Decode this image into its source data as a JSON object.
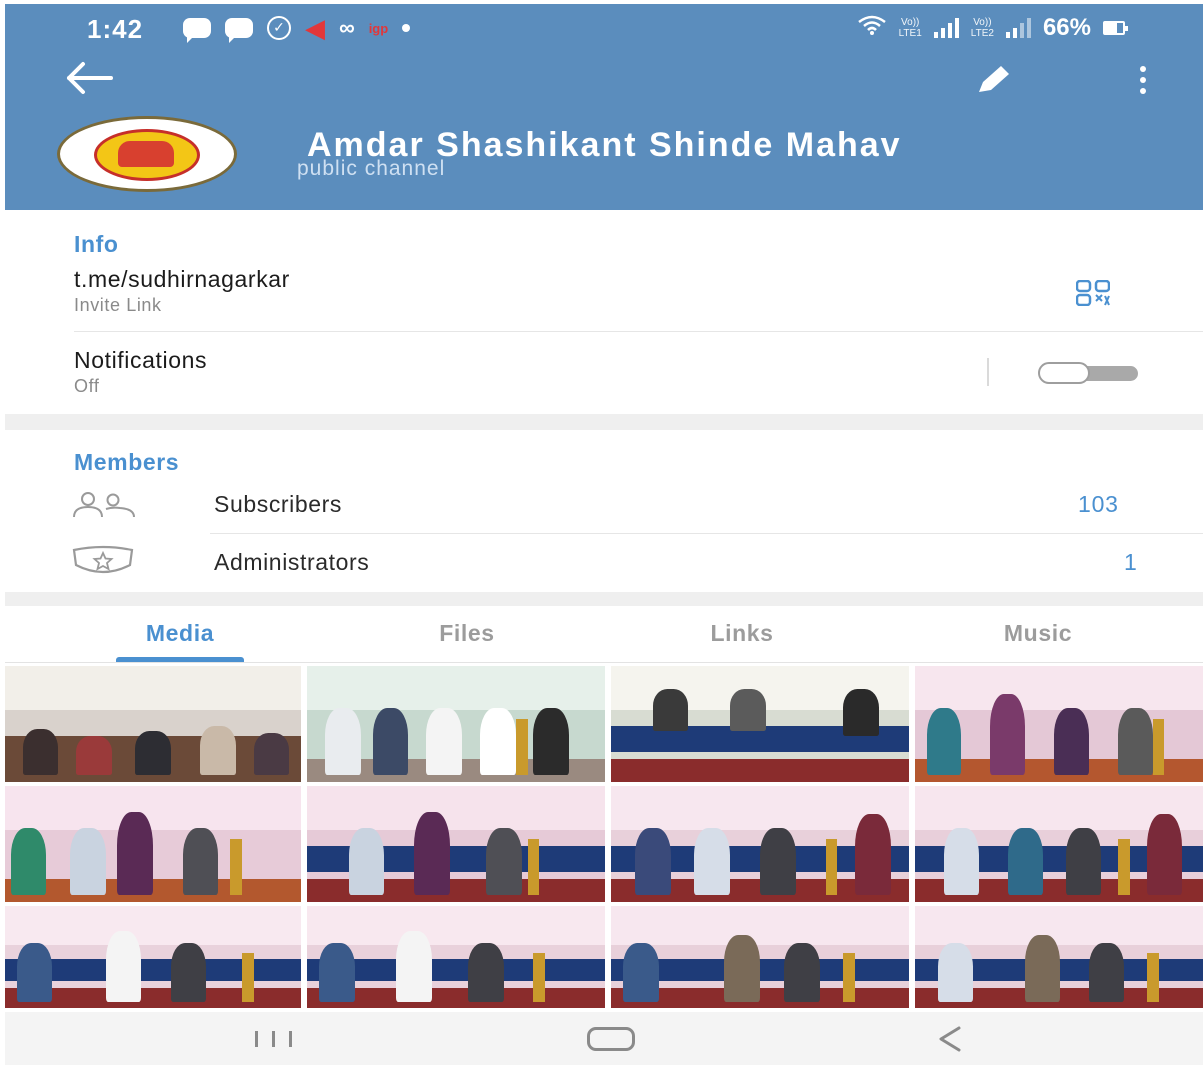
{
  "status_bar": {
    "time": "1:42",
    "app_badge": "igp",
    "volte_1_top": "Vo))",
    "volte_1_bottom": "LTE1",
    "volte_2_top": "Vo))",
    "volte_2_bottom": "LTE2",
    "battery": "66%"
  },
  "header": {
    "channel_name": "Amdar Shashikant Shinde Mahav",
    "channel_type": "public channel"
  },
  "info": {
    "section_label": "Info",
    "link": "t.me/sudhirnagarkar",
    "link_caption": "Invite Link",
    "notifications_label": "Notifications",
    "notifications_state": "Off",
    "notifications_on": false
  },
  "members": {
    "section_label": "Members",
    "subscribers_label": "Subscribers",
    "subscribers_count": "103",
    "administrators_label": "Administrators",
    "administrators_count": "1"
  },
  "tabs": [
    {
      "label": "Media",
      "active": true
    },
    {
      "label": "Files",
      "active": false
    },
    {
      "label": "Links",
      "active": false
    },
    {
      "label": "Music",
      "active": false
    }
  ],
  "icons": {
    "back": "back-arrow-icon",
    "edit": "pencil-icon",
    "more": "more-vertical-icon",
    "qr": "qr-code-icon",
    "subscribers": "people-icon",
    "administrators": "shield-star-icon",
    "nav_recent": "recent-apps-icon",
    "nav_home": "home-icon",
    "nav_back": "nav-back-icon"
  },
  "colors": {
    "header_bg": "#5b8dbd",
    "accent": "#4a90d0"
  }
}
